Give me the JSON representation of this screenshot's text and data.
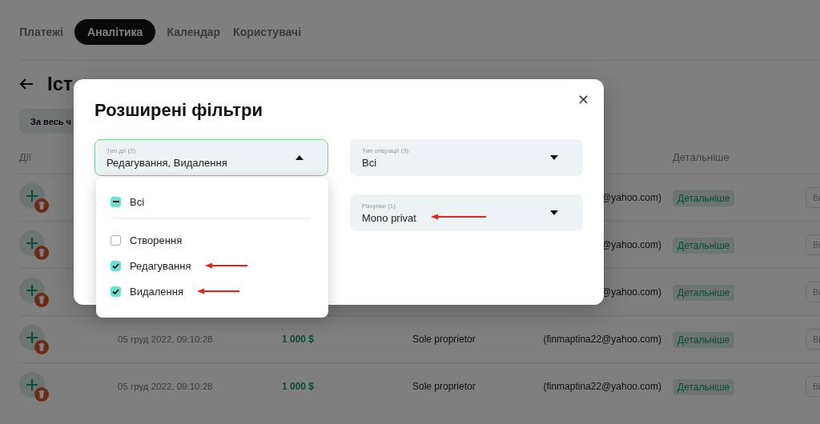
{
  "tabs": [
    {
      "label": "Платежі",
      "selected": false
    },
    {
      "label": "Аналітика",
      "selected": true
    },
    {
      "label": "Календар",
      "selected": false
    },
    {
      "label": "Користувачі",
      "selected": false
    }
  ],
  "page_title": "Іст",
  "period_chip": "За весь ч",
  "table": {
    "columns": [
      {
        "label": "Дії"
      },
      {
        "label": "Детальніше"
      }
    ],
    "rows": [
      {
        "email": "@yahoo.com)",
        "details": "Детальніше",
        "column_7": "Ві"
      },
      {
        "email": "@yahoo.com)",
        "details": "Детальніше",
        "column_7": "Ві"
      },
      {
        "email": "@yahoo.com)",
        "details": "Детальніше",
        "column_7": "Ві"
      },
      {
        "date": "05 груд 2022, 09:10:28",
        "amount": "1 000 $",
        "type": "Sole proprietor",
        "email": "(finmaptina22@yahoo.com)",
        "details": "Детальніше",
        "column_7": "Ві"
      },
      {
        "date": "05 груд 2022, 09:10:28",
        "amount": "1 000 $",
        "type": "Sole proprietor",
        "email": "(finmaptina22@yahoo.com)",
        "details": "Детальніше",
        "column_7": "Ві"
      }
    ]
  },
  "modal": {
    "title": "Розширені фільтри",
    "close": "×",
    "fields": [
      {
        "label": "Тип дії (2)",
        "value": "Редагування, Видалення",
        "expanded": true,
        "marked": false
      },
      {
        "label": "Тип операції (3)",
        "value": "Всі",
        "expanded": false,
        "marked": false
      },
      {
        "label": "Рахунки (1)",
        "value": "Mono privat",
        "expanded": false,
        "marked": true
      }
    ]
  },
  "dropdown": {
    "select_all": {
      "label": "Всі",
      "partial": true
    },
    "options": [
      {
        "label": "Створення",
        "checked": false,
        "marked": false
      },
      {
        "label": "Редагування",
        "checked": true,
        "marked": true
      },
      {
        "label": "Видалення",
        "checked": true,
        "marked": true
      }
    ]
  }
}
